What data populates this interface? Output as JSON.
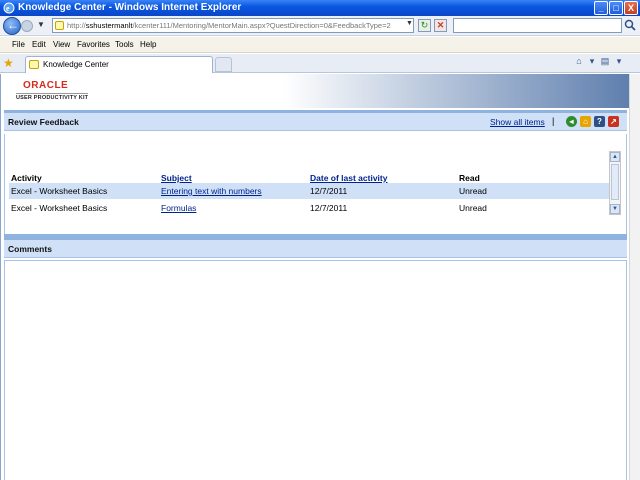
{
  "window": {
    "title": "Knowledge Center - Windows Internet Explorer",
    "buttons": [
      "_",
      "□",
      "X"
    ]
  },
  "address_bar": {
    "url_prefix": "http://",
    "url_host": "sshustermanlt",
    "url_path": "/kcenter111/Mentoring/MentorMain.aspx?QuestDirection=0&FeedbackType=2"
  },
  "menu": [
    "File",
    "Edit",
    "View",
    "Favorites",
    "Tools",
    "Help"
  ],
  "tab": {
    "label": "Knowledge Center"
  },
  "branding": {
    "oracle": "ORACLE",
    "product": "USER PRODUCTIVITY KIT"
  },
  "review_panel": {
    "title": "Review Feedback",
    "show_all": "Show all items",
    "separator": "|"
  },
  "table": {
    "headers": [
      "Activity",
      "Subject",
      "Date of last activity",
      "Read"
    ],
    "rows": [
      {
        "activity": "Excel - Worksheet Basics",
        "subject": "Entering text with numbers",
        "date": "12/7/2011",
        "read": "Unread",
        "selected": true
      },
      {
        "activity": "Excel - Worksheet Basics",
        "subject": "Formulas",
        "date": "12/7/2011",
        "read": "Unread",
        "selected": false
      }
    ]
  },
  "comments_panel": {
    "title": "Comments"
  },
  "colors": {
    "title_bar": "#0a58e0",
    "panel_header": "#cfe0f7",
    "link": "#00238f",
    "oracle_red": "#d52b1e"
  }
}
